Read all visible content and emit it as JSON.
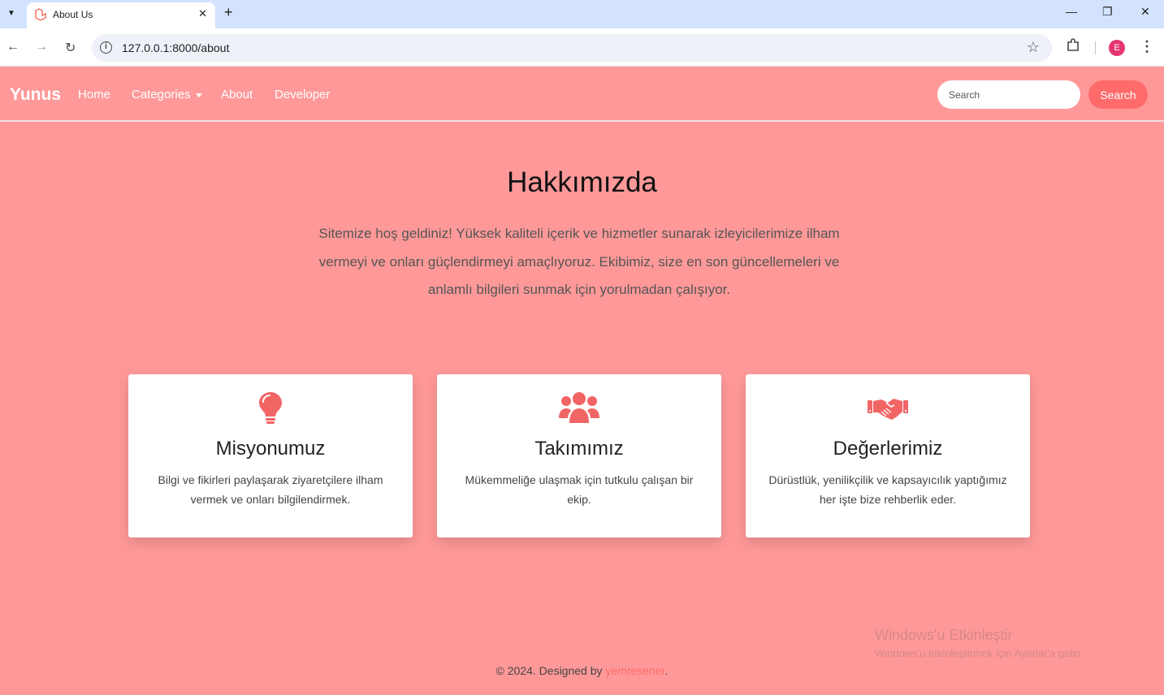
{
  "browser": {
    "tab_title": "About Us",
    "url": "127.0.0.1:8000/about",
    "profile_initial": "E"
  },
  "navbar": {
    "brand": "Yunus",
    "links": [
      "Home",
      "Categories",
      "About",
      "Developer"
    ],
    "search_placeholder": "Search",
    "search_button": "Search"
  },
  "main": {
    "title": "Hakkımızda",
    "intro": "Sitemize hoş geldiniz! Yüksek kaliteli içerik ve hizmetler sunarak izleyicilerimize ilham vermeyi ve onları güçlendirmeyi amaçlıyoruz. Ekibimiz, size en son güncellemeleri ve anlamlı bilgileri sunmak için yorulmadan çalışıyor.",
    "cards": [
      {
        "icon": "lightbulb-icon",
        "title": "Misyonumuz",
        "text": "Bilgi ve fikirleri paylaşarak ziyaretçilere ilham vermek ve onları bilgilendirmek."
      },
      {
        "icon": "users-icon",
        "title": "Takımımız",
        "text": "Mükemmeliğe ulaşmak için tutkulu çalışan bir ekip."
      },
      {
        "icon": "handshake-icon",
        "title": "Değerlerimiz",
        "text": "Dürüstlük, yenilikçilik ve kapsayıcılık yaptığımız her işte bize rehberlik eder."
      }
    ]
  },
  "watermark": {
    "line1": "Windows'u Etkinleştir",
    "line2": "Windows'u etkinleştirmek için Ayarlar'a gidin."
  },
  "footer": {
    "prefix": "© 2024. Designed by ",
    "link": "yemresener",
    "suffix": "."
  },
  "colors": {
    "page_bg": "#ff9999",
    "accent": "#ff6b6b"
  }
}
